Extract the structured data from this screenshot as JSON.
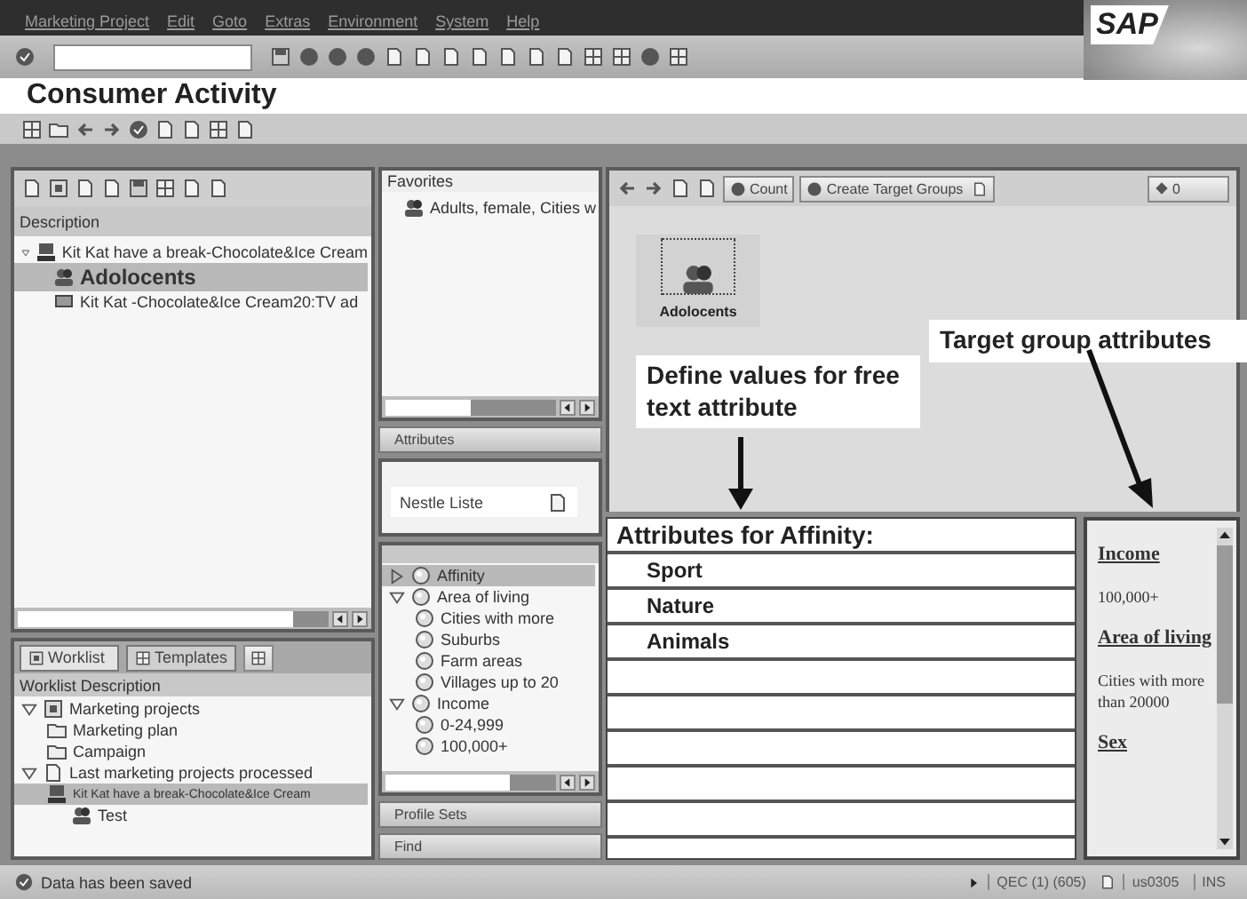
{
  "menu": [
    "Marketing Project",
    "Edit",
    "Goto",
    "Extras",
    "Environment",
    "System",
    "Help"
  ],
  "logo": "SAP",
  "title": "Consumer Activity",
  "left_panel": {
    "header": "Description",
    "tree": [
      {
        "label": "Kit Kat have a break-Chocolate&Ice Cream",
        "kind": "project",
        "expanded": true,
        "selected": false,
        "children": [
          {
            "label": "Adolocents",
            "kind": "group",
            "selected": true
          },
          {
            "label": "Kit Kat -Chocolate&Ice Cream20:TV ad",
            "kind": "media",
            "selected": false
          }
        ]
      }
    ]
  },
  "worklist": {
    "tabs": [
      {
        "label": "Worklist",
        "selected": true
      },
      {
        "label": "Templates",
        "selected": false
      }
    ],
    "header": "Worklist Description",
    "tree": [
      {
        "label": "Marketing projects",
        "kind": "box",
        "expanded": true,
        "selected": false,
        "children": [
          {
            "label": "Marketing plan",
            "kind": "folder",
            "selected": false
          },
          {
            "label": "Campaign",
            "kind": "folder",
            "selected": false
          }
        ]
      },
      {
        "label": "Last marketing projects processed",
        "kind": "doc",
        "expanded": true,
        "selected": false,
        "children": [
          {
            "label": "Kit Kat have a break-Chocolate&Ice Cream",
            "kind": "project",
            "small": true,
            "selected": true,
            "children": [
              {
                "label": "Test",
                "kind": "group",
                "selected": false
              }
            ]
          }
        ]
      }
    ]
  },
  "middle": {
    "favorites": {
      "header": "Favorites",
      "items": [
        "Adults, female, Cities w"
      ]
    },
    "attributes_button": "Attributes",
    "dropdown_value": "Nestle Liste",
    "tree": [
      {
        "label": "Affinity",
        "expanded": false,
        "selected": true
      },
      {
        "label": "Area of living",
        "expanded": true,
        "selected": false,
        "children": [
          {
            "label": "Cities with more",
            "selected": false
          },
          {
            "label": "Suburbs",
            "selected": false
          },
          {
            "label": "Farm areas",
            "selected": false
          },
          {
            "label": "Villages up to 20",
            "selected": false
          }
        ]
      },
      {
        "label": "Income",
        "expanded": true,
        "selected": false,
        "children": [
          {
            "label": "0-24,999",
            "selected": false
          },
          {
            "label": "100,000+",
            "selected": false
          }
        ]
      }
    ],
    "buttons": [
      "Profile Sets",
      "Find"
    ]
  },
  "right": {
    "toolbar": {
      "count": "Count",
      "create": "Create Target Groups",
      "counter": "0"
    },
    "node": {
      "label": "Adolocents",
      "selected": true
    },
    "annotations": [
      {
        "text": "Target group attributes",
        "kind": "right"
      },
      {
        "text": "Define values for free text attribute",
        "kind": "left"
      }
    ],
    "table": {
      "heading": "Attributes for Affinity:",
      "rows": [
        "Sport",
        "Nature",
        "Animals",
        "",
        "",
        "",
        "",
        ""
      ]
    },
    "attribute_panel": [
      {
        "kind": "heading",
        "text": "Income"
      },
      {
        "kind": "value",
        "text": "100,000+"
      },
      {
        "kind": "heading",
        "text": "Area of living"
      },
      {
        "kind": "value",
        "text": "Cities with more than 20000"
      },
      {
        "kind": "heading",
        "text": "Sex"
      }
    ]
  },
  "status_bar": {
    "message": "Data has been saved",
    "system": "QEC (1) (605)",
    "user": "us0305",
    "mode": "INS"
  }
}
